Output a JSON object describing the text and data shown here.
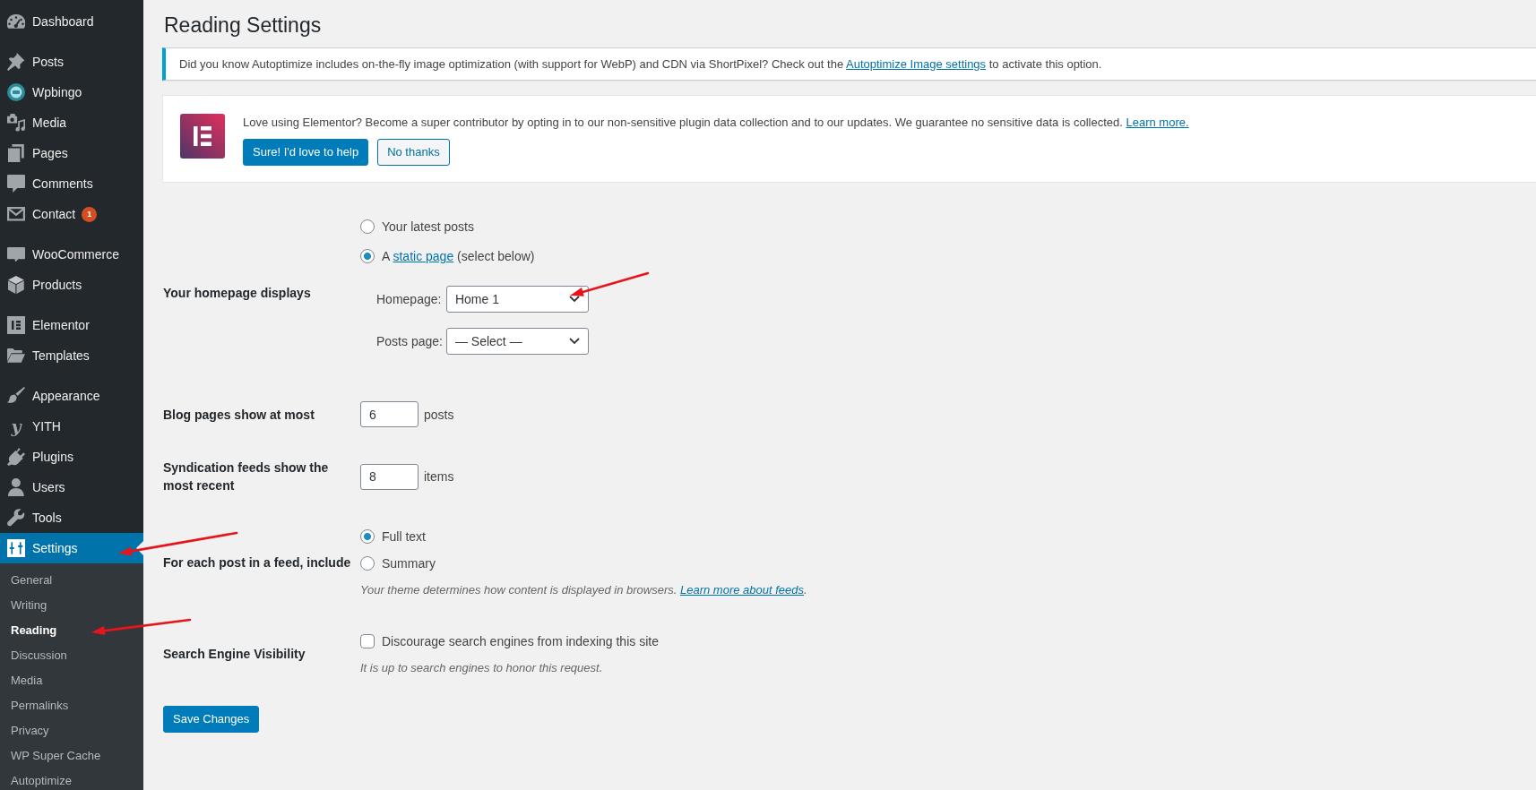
{
  "sidebar": {
    "groups": [
      {
        "items": [
          {
            "label": "Dashboard",
            "selected": false
          }
        ]
      },
      {
        "items": [
          {
            "label": "Posts",
            "selected": false
          },
          {
            "label": "Wpbingo",
            "selected": false
          },
          {
            "label": "Media",
            "selected": false
          },
          {
            "label": "Pages",
            "selected": false
          },
          {
            "label": "Comments",
            "selected": false
          },
          {
            "label": "Contact",
            "selected": false,
            "badge": "1"
          }
        ]
      },
      {
        "items": [
          {
            "label": "WooCommerce",
            "selected": false
          },
          {
            "label": "Products",
            "selected": false
          }
        ]
      },
      {
        "items": [
          {
            "label": "Elementor",
            "selected": false
          },
          {
            "label": "Templates",
            "selected": false
          }
        ]
      },
      {
        "items": [
          {
            "label": "Appearance",
            "selected": false
          },
          {
            "label": "YITH",
            "selected": false,
            "icon_text": "y"
          },
          {
            "label": "Plugins",
            "selected": false
          },
          {
            "label": "Users",
            "selected": false
          },
          {
            "label": "Tools",
            "selected": false
          },
          {
            "label": "Settings",
            "selected": true,
            "children": [
              {
                "label": "General",
                "selected": false
              },
              {
                "label": "Writing",
                "selected": false
              },
              {
                "label": "Reading",
                "selected": true
              },
              {
                "label": "Discussion",
                "selected": false
              },
              {
                "label": "Media",
                "selected": false
              },
              {
                "label": "Permalinks",
                "selected": false
              },
              {
                "label": "Privacy",
                "selected": false
              },
              {
                "label": "WP Super Cache",
                "selected": false
              },
              {
                "label": "Autoptimize",
                "selected": false
              }
            ]
          }
        ]
      }
    ]
  },
  "page": {
    "title": "Reading Settings"
  },
  "notices": [
    {
      "kind": "info",
      "text": "Did you know Autoptimize includes on-the-fly image optimization (with support for WebP) and CDN via ShortPixel? Check out the",
      "link": "Autoptimize Image settings",
      "text_after": "to activate this option."
    },
    {
      "kind": "optin",
      "text": "Love using Elementor? Become a super contributor by opting in to our non-sensitive plugin data collection and to our updates. We guarantee no sensitive data is collected.",
      "link": "Learn more.",
      "buttons": [
        {
          "label": "Sure! I'd love to help",
          "kind": "primary"
        },
        {
          "label": "No thanks",
          "kind": "secondary"
        }
      ]
    }
  ],
  "settings": [
    {
      "kind": "radio_group",
      "label": "Your homepage displays",
      "options": [
        {
          "text": "Your latest posts",
          "selected": false
        },
        {
          "text": "A",
          "link": "static page",
          "text_after": "(select below)",
          "selected": true
        }
      ],
      "selects": [
        {
          "label": "Homepage:",
          "value": "Home 1"
        },
        {
          "label": "Posts page:",
          "value": "— Select —"
        }
      ]
    },
    {
      "kind": "number",
      "label": "Blog pages show at most",
      "value": "6",
      "unit": "posts"
    },
    {
      "kind": "number",
      "label": "Syndication feeds show the most recent",
      "value": "8",
      "unit": "items"
    },
    {
      "kind": "radio_group",
      "label": "For each post in a feed, include",
      "options": [
        {
          "text": "Full text",
          "selected": true
        },
        {
          "text": "Summary",
          "selected": false
        }
      ],
      "description": "Your theme determines how content is displayed in browsers.",
      "description_link": "Learn more about feeds",
      "description_after": "."
    },
    {
      "kind": "checkbox",
      "label": "Search Engine Visibility",
      "text": "Discourage search engines from indexing this site",
      "checked": false,
      "description": "It is up to search engines to honor this request."
    }
  ],
  "save_button": {
    "label": "Save Changes"
  }
}
